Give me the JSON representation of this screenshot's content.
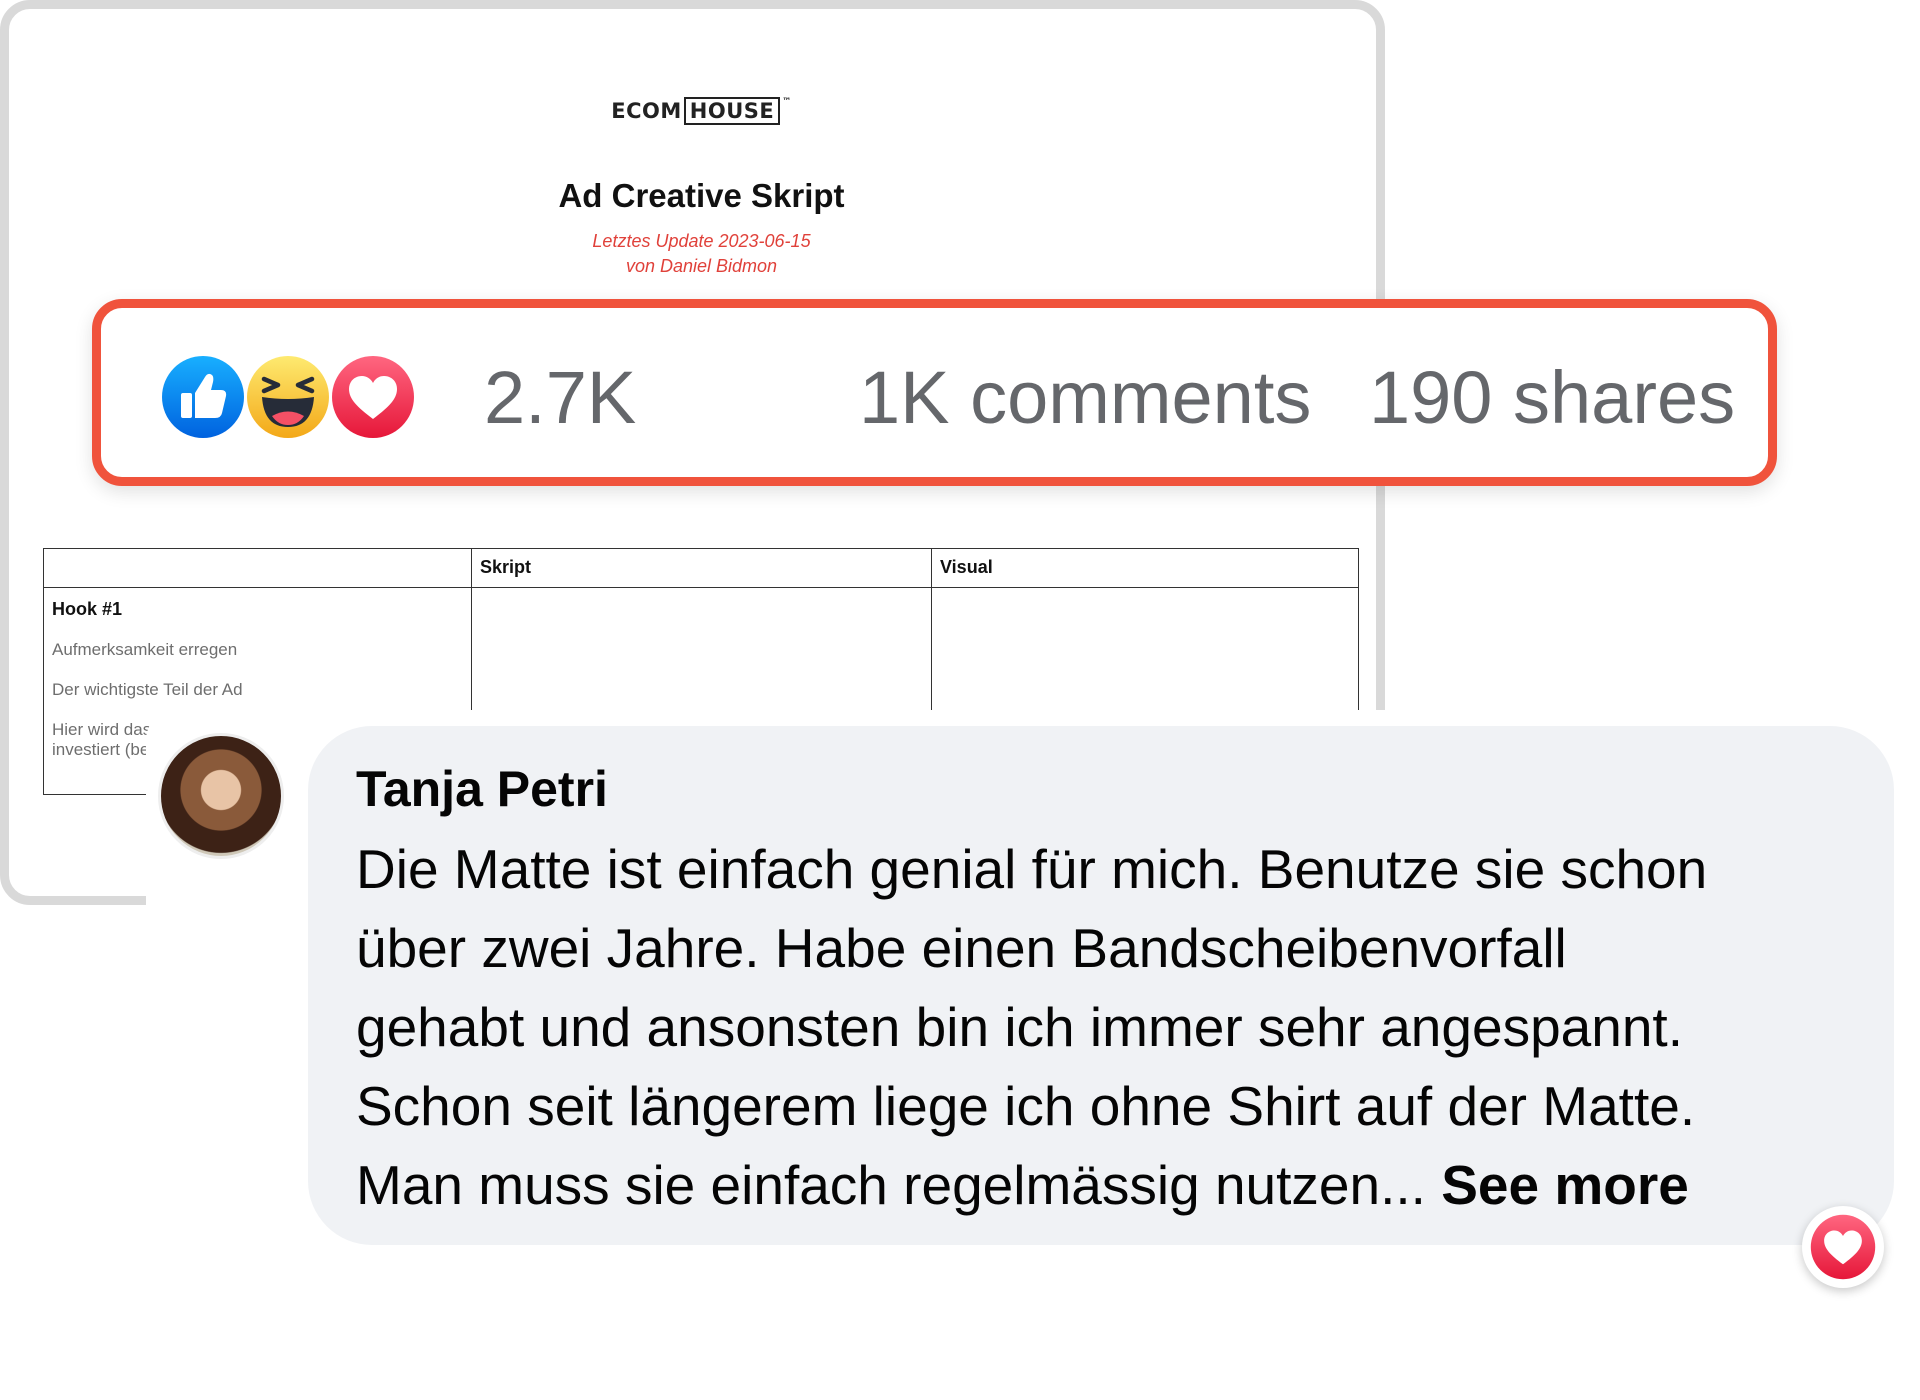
{
  "document": {
    "logo": {
      "left": "ECOM",
      "boxed": "HOUSE",
      "trademark": "™"
    },
    "title": "Ad Creative Skript",
    "updated": "Letztes Update 2023-06-15",
    "author": "von Daniel Bidmon",
    "colors": {
      "meta_red": "#e0413a"
    },
    "table": {
      "headers": [
        "",
        "Skript",
        "Visual"
      ],
      "row": {
        "title": "Hook #1",
        "lines": [
          "Aufmerksamkeit erregen",
          "Der wichtigste Teil der Ad",
          "Hier wird das",
          "investiert (be"
        ]
      }
    }
  },
  "reactions": {
    "icons": [
      "like-icon",
      "haha-icon",
      "love-icon"
    ],
    "count": "2.7K",
    "comments": "1K comments",
    "shares": "190 shares",
    "colors": {
      "highlight_border": "#f0533c",
      "like_blue": "#1877f2",
      "love_red": "#f33e58",
      "haha_yellow": "#f7b125",
      "count_gray": "#65676b"
    }
  },
  "comment": {
    "author": "Tanja Petri",
    "lines": [
      "Die Matte ist einfach genial für mich. Benutze sie schon",
      "über zwei Jahre. Habe einen Bandscheibenvorfall",
      "gehabt und ansonsten bin ich immer sehr angespannt.",
      "Schon seit längerem liege ich ohne Shirt auf der Matte.",
      "Man muss sie einfach regelmässig nutzen... "
    ],
    "see_more": "See more",
    "reaction_icon": "love-icon",
    "colors": {
      "bubble_bg": "#f0f2f5"
    }
  }
}
